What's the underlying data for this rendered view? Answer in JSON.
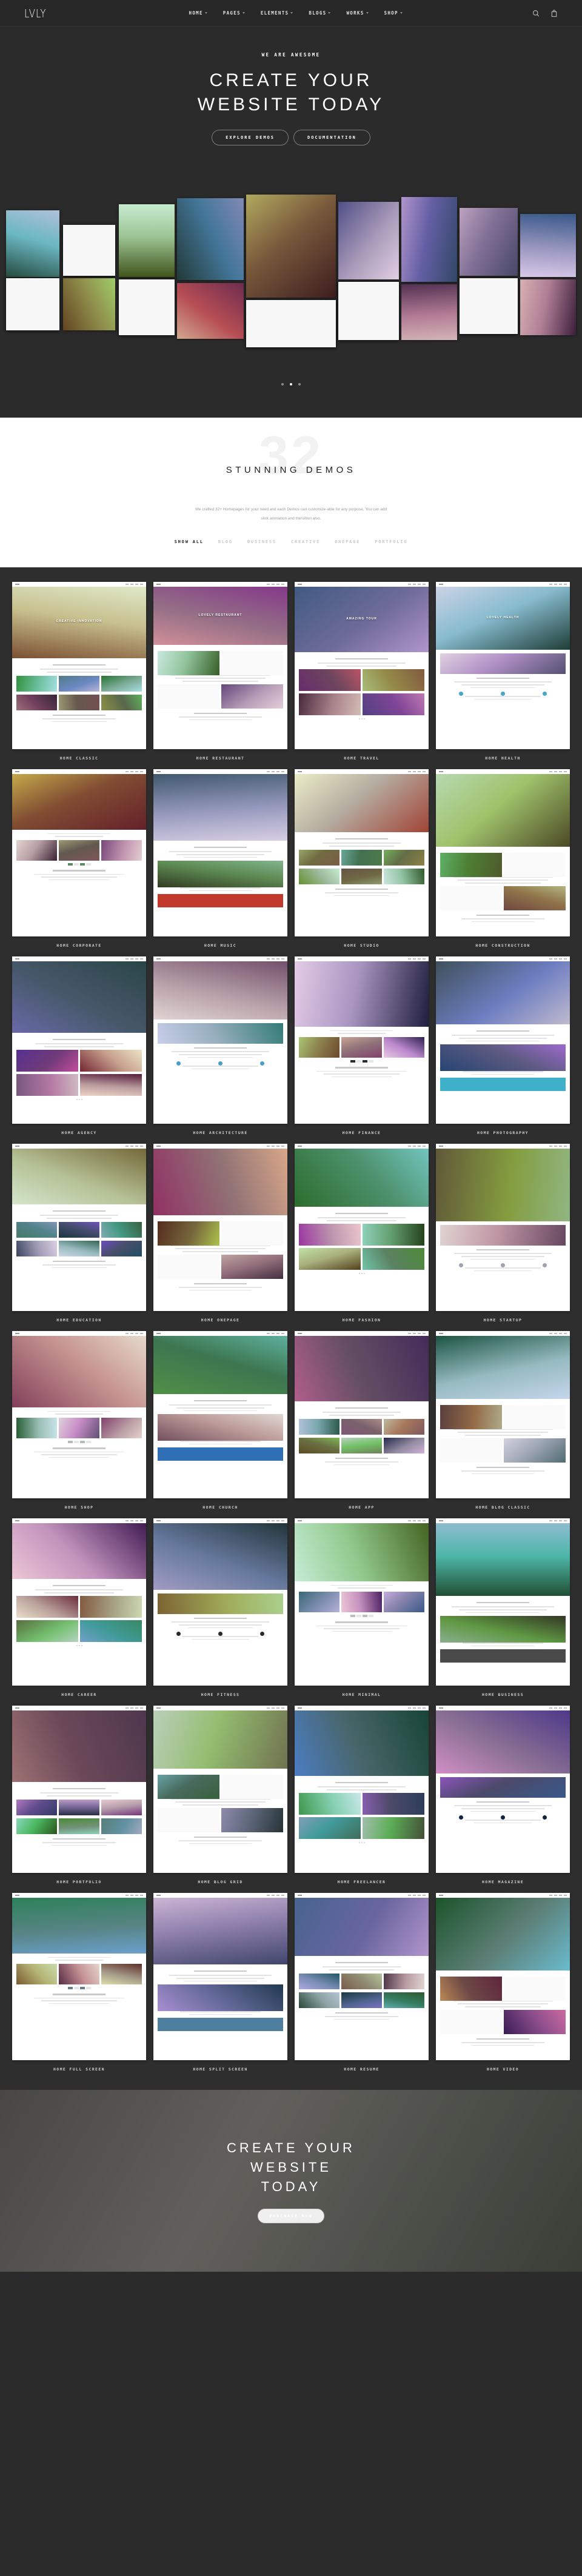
{
  "header": {
    "logo": "LVLY",
    "nav": [
      {
        "label": "HOME"
      },
      {
        "label": "PAGES"
      },
      {
        "label": "ELEMENTS"
      },
      {
        "label": "BLOGS"
      },
      {
        "label": "WORKS"
      },
      {
        "label": "SHOP"
      }
    ],
    "icons": [
      {
        "name": "search-icon"
      },
      {
        "name": "cart-icon"
      }
    ]
  },
  "hero": {
    "eyebrow": "WE ARE AWESOME",
    "title_line1": "CREATE YOUR",
    "title_line2": "WEBSITE TODAY",
    "buttons": [
      {
        "label": "EXPLORE DEMOS"
      },
      {
        "label": "DOCUMENTATION"
      }
    ],
    "slider_dots": 3,
    "active_dot": 1
  },
  "demos": {
    "watermark_number": "32",
    "title": "STUNNING DEMOS",
    "description": "We crafted 32+ Homepages for your need and each Demos can customize-able for any purpose, You can add slick animation and transition also.",
    "filters": [
      {
        "label": "SHOW ALL",
        "active": true
      },
      {
        "label": "BLOG",
        "active": false
      },
      {
        "label": "BUSINESS",
        "active": false
      },
      {
        "label": "CREATIVE",
        "active": false
      },
      {
        "label": "ONEPAGE",
        "active": false
      },
      {
        "label": "PORTFOLIO",
        "active": false
      }
    ],
    "items": [
      {
        "label": "HOME CLASSIC",
        "style": "classic",
        "hero_caption": "CREATIVE INNOVATION",
        "accent": "#3a3a3a"
      },
      {
        "label": "HOME RESTAURANT",
        "style": "restaurant",
        "hero_caption": "LOVELY RESTAURANT",
        "accent": "#8c2f2f"
      },
      {
        "label": "HOME TRAVEL",
        "style": "travel",
        "hero_caption": "AMAZING TOUR",
        "accent": "#1d3f7a"
      },
      {
        "label": "HOME HEALTH",
        "style": "health",
        "hero_caption": "LOVELY HEALTH",
        "accent": "#4aa7c4"
      },
      {
        "label": "HOME CORPORATE",
        "style": "corporate",
        "hero_caption": "",
        "accent": "#5b8a60"
      },
      {
        "label": "HOME MUSIC",
        "style": "music",
        "hero_caption": "",
        "accent": "#c0392b"
      },
      {
        "label": "HOME STUDIO",
        "style": "studio",
        "hero_caption": "",
        "accent": "#b9a894"
      },
      {
        "label": "HOME CONSTRUCTION",
        "style": "construction",
        "hero_caption": "",
        "accent": "#4fb3d9"
      },
      {
        "label": "HOME AGENCY",
        "style": "agency",
        "hero_caption": "",
        "accent": "#8f8f8f"
      },
      {
        "label": "HOME ARCHITECTURE",
        "style": "architecture",
        "hero_caption": "",
        "accent": "#4a9fc7"
      },
      {
        "label": "HOME FINANCE",
        "style": "finance",
        "hero_caption": "",
        "accent": "#2a2a2a"
      },
      {
        "label": "HOME PHOTOGRAPHY",
        "style": "photography",
        "hero_caption": "",
        "accent": "#3fb0c9"
      },
      {
        "label": "HOME EDUCATION",
        "style": "education",
        "hero_caption": "",
        "accent": "#3c6e9a"
      },
      {
        "label": "HOME ONEPAGE",
        "style": "onepage",
        "hero_caption": "",
        "accent": "#d8d8d8"
      },
      {
        "label": "HOME FASHION",
        "style": "fashion",
        "hero_caption": "",
        "accent": "#c9b7a6"
      },
      {
        "label": "HOME STARTUP",
        "style": "startup",
        "hero_caption": "",
        "accent": "#9fa4ad"
      },
      {
        "label": "HOME SHOP",
        "style": "shop",
        "hero_caption": "",
        "accent": "#b8b8b8"
      },
      {
        "label": "HOME CHURCH",
        "style": "church",
        "hero_caption": "",
        "accent": "#2f6fb5"
      },
      {
        "label": "HOME APP",
        "style": "app",
        "hero_caption": "",
        "accent": "#e8503a"
      },
      {
        "label": "HOME BLOG CLASSIC",
        "style": "blogclassic",
        "hero_caption": "",
        "accent": "#cdb9a8"
      },
      {
        "label": "HOME CAREER",
        "style": "career",
        "hero_caption": "",
        "accent": "#7c7c7c"
      },
      {
        "label": "HOME FITNESS",
        "style": "fitness",
        "hero_caption": "",
        "accent": "#2a2a2a"
      },
      {
        "label": "HOME MINIMAL",
        "style": "minimal",
        "hero_caption": "",
        "accent": "#bdbdbd"
      },
      {
        "label": "HOME BUSINESS",
        "style": "business",
        "hero_caption": "",
        "accent": "#4a4a4a"
      },
      {
        "label": "HOME PORTFOLIO",
        "style": "portfolio",
        "hero_caption": "",
        "accent": "#2a2a2a"
      },
      {
        "label": "HOME BLOG GRID",
        "style": "bloggrid",
        "hero_caption": "",
        "accent": "#b5743a"
      },
      {
        "label": "HOME FREELANCER",
        "style": "freelancer",
        "hero_caption": "",
        "accent": "#f0c419"
      },
      {
        "label": "HOME MAGAZINE",
        "style": "magazine",
        "hero_caption": "",
        "accent": "#14243f"
      },
      {
        "label": "HOME FULL SCREEN",
        "style": "fullscreen",
        "hero_caption": "",
        "accent": "#6c7d89"
      },
      {
        "label": "HOME SPLIT SCREEN",
        "style": "splitscreen",
        "hero_caption": "",
        "accent": "#4f7f9e"
      },
      {
        "label": "HOME RESUME",
        "style": "resume",
        "hero_caption": "",
        "accent": "#9a9a9a"
      },
      {
        "label": "HOME VIDEO",
        "style": "video",
        "hero_caption": "",
        "accent": "#1a1a1a"
      }
    ]
  },
  "cta": {
    "title_line1": "CREATE YOUR",
    "title_line2": "WEBSITE",
    "title_line3": "TODAY",
    "button": "PURCHASE NOW"
  }
}
